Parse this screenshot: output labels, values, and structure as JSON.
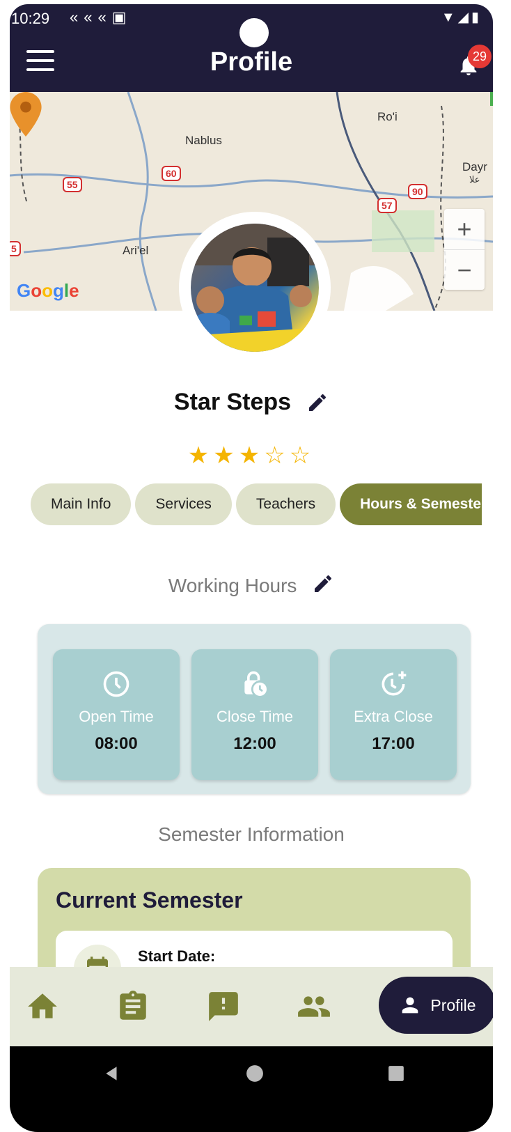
{
  "status": {
    "time": "10:29"
  },
  "header": {
    "title": "Profile",
    "notification_count": "29"
  },
  "map": {
    "labels": {
      "nablus": "Nablus",
      "roi": "Ro'i",
      "dayr": "Dayr",
      "dayr2": "علا",
      "ariel": "Ari'el"
    },
    "shields": {
      "r55": "55",
      "r60": "60",
      "r90": "90",
      "r57": "57",
      "r5": "5"
    },
    "zoom_in": "+",
    "zoom_out": "−",
    "attribution": "Google"
  },
  "profile": {
    "name": "Star Steps",
    "rating": 3,
    "rating_max": 5
  },
  "tabs": [
    {
      "label": "Main Info"
    },
    {
      "label": "Services"
    },
    {
      "label": "Teachers"
    },
    {
      "label": "Hours & Semesters"
    }
  ],
  "working_hours": {
    "title": "Working Hours",
    "cards": [
      {
        "label": "Open Time",
        "value": "08:00",
        "icon": "clock-icon"
      },
      {
        "label": "Close Time",
        "value": "12:00",
        "icon": "lock-clock-icon"
      },
      {
        "label": "Extra Close",
        "value": "17:00",
        "icon": "more-time-icon"
      }
    ]
  },
  "semester": {
    "section_title": "Semester Information",
    "card_title": "Current Semester",
    "start_label": "Start Date:"
  },
  "bottom_nav": {
    "profile_label": "Profile"
  },
  "colors": {
    "header": "#1f1c3a",
    "accent": "#7b8236",
    "tab_bg": "#dfe2cb",
    "hours_card": "#a8cfd0",
    "semester_card": "#d3dba9",
    "star": "#f4b400"
  }
}
